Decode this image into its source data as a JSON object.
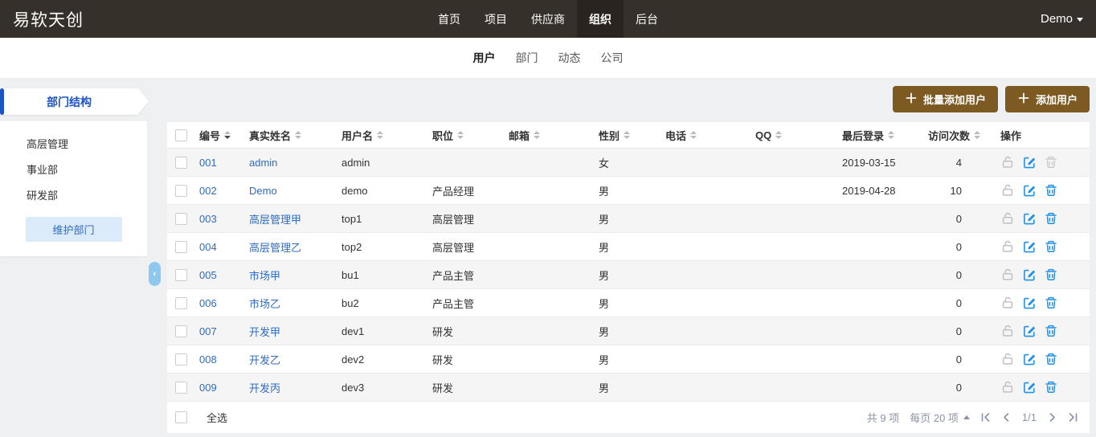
{
  "topbar": {
    "logo": "易软天创",
    "nav": [
      {
        "label": "首页",
        "active": false
      },
      {
        "label": "项目",
        "active": false
      },
      {
        "label": "供应商",
        "active": false
      },
      {
        "label": "组织",
        "active": true
      },
      {
        "label": "后台",
        "active": false
      }
    ],
    "user": "Demo"
  },
  "subnav": {
    "tabs": [
      {
        "label": "用户",
        "active": true
      },
      {
        "label": "部门",
        "active": false
      },
      {
        "label": "动态",
        "active": false
      },
      {
        "label": "公司",
        "active": false
      }
    ]
  },
  "sidebar": {
    "title": "部门结构",
    "items": [
      "高层管理",
      "事业部",
      "研发部"
    ],
    "maintain_button": "维护部门"
  },
  "toolbar": {
    "plus_icon": "＋",
    "batch_add_label": "批量添加用户",
    "add_label": "添加用户"
  },
  "table": {
    "headers": [
      {
        "key": "id",
        "label": "编号",
        "sort": true,
        "active": "down"
      },
      {
        "key": "realname",
        "label": "真实姓名",
        "sort": true
      },
      {
        "key": "account",
        "label": "用户名",
        "sort": true
      },
      {
        "key": "role",
        "label": "职位",
        "sort": true
      },
      {
        "key": "email",
        "label": "邮箱",
        "sort": true
      },
      {
        "key": "gender",
        "label": "性别",
        "sort": true
      },
      {
        "key": "phone",
        "label": "电话",
        "sort": true
      },
      {
        "key": "qq",
        "label": "QQ",
        "sort": true
      },
      {
        "key": "login",
        "label": "最后登录",
        "sort": true
      },
      {
        "key": "visits",
        "label": "访问次数",
        "sort": true
      },
      {
        "key": "ops",
        "label": "操作",
        "sort": false
      }
    ],
    "rows": [
      {
        "id": "001",
        "realname": "admin",
        "account": "admin",
        "role": "",
        "email": "",
        "gender": "女",
        "phone": "",
        "qq": "",
        "last_login": "2019-03-15",
        "visits": "4",
        "trash_disabled": true
      },
      {
        "id": "002",
        "realname": "Demo",
        "account": "demo",
        "role": "产品经理",
        "email": "",
        "gender": "男",
        "phone": "",
        "qq": "",
        "last_login": "2019-04-28",
        "visits": "10"
      },
      {
        "id": "003",
        "realname": "高层管理甲",
        "account": "top1",
        "role": "高层管理",
        "email": "",
        "gender": "男",
        "phone": "",
        "qq": "",
        "last_login": "",
        "visits": "0"
      },
      {
        "id": "004",
        "realname": "高层管理乙",
        "account": "top2",
        "role": "高层管理",
        "email": "",
        "gender": "男",
        "phone": "",
        "qq": "",
        "last_login": "",
        "visits": "0"
      },
      {
        "id": "005",
        "realname": "市场甲",
        "account": "bu1",
        "role": "产品主管",
        "email": "",
        "gender": "男",
        "phone": "",
        "qq": "",
        "last_login": "",
        "visits": "0"
      },
      {
        "id": "006",
        "realname": "市场乙",
        "account": "bu2",
        "role": "产品主管",
        "email": "",
        "gender": "男",
        "phone": "",
        "qq": "",
        "last_login": "",
        "visits": "0"
      },
      {
        "id": "007",
        "realname": "开发甲",
        "account": "dev1",
        "role": "研发",
        "email": "",
        "gender": "男",
        "phone": "",
        "qq": "",
        "last_login": "",
        "visits": "0"
      },
      {
        "id": "008",
        "realname": "开发乙",
        "account": "dev2",
        "role": "研发",
        "email": "",
        "gender": "男",
        "phone": "",
        "qq": "",
        "last_login": "",
        "visits": "0"
      },
      {
        "id": "009",
        "realname": "开发丙",
        "account": "dev3",
        "role": "研发",
        "email": "",
        "gender": "男",
        "phone": "",
        "qq": "",
        "last_login": "",
        "visits": "0"
      }
    ],
    "footer": {
      "select_all": "全选",
      "total": "共 9 项",
      "per_page": "每页 20 项",
      "page": "1/1"
    }
  },
  "colors": {
    "topbar_bg": "#36302b",
    "topbar_active_bg": "#2a2420",
    "accent_brown": "#7d5a21",
    "link_blue": "#2f6bbf",
    "sidebar_accent_blue": "#1d54c4",
    "action_icon_blue": "#2090ea",
    "collapse_handle_blue": "#8fc8ef",
    "page_bg": "#eff0f2",
    "row_alt_bg": "#f5f5f6"
  }
}
